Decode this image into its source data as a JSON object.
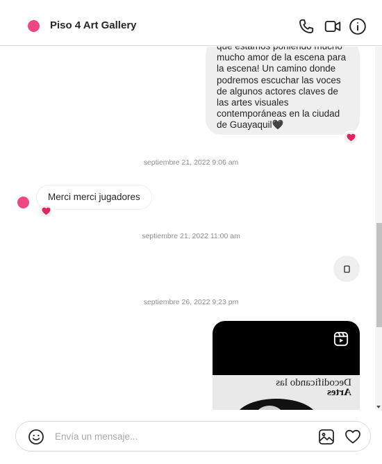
{
  "header": {
    "title": "Piso 4 Art Gallery",
    "avatar_color": "#f0477f",
    "icons": [
      "phone-icon",
      "video-icon",
      "info-icon"
    ]
  },
  "thread": {
    "outgoing_message": "que estamos poniendo mucho mucho amor de la escena para la escena! Un camino donde podremos escuchar las voces de algunos actores claves de las artes visuales contemporáneas en la ciudad de Guayaquil🖤",
    "timestamps": [
      "septiembre 21, 2022 9:06 am",
      "septiembre 21, 2022 11:00 am",
      "septiembre 26, 2022 9:23 pm"
    ],
    "incoming_message": "Merci merci jugadores",
    "reel_preview_text": {
      "line1": "Decodificando las",
      "line2": "Artes"
    }
  },
  "composer": {
    "placeholder": "Envía un mensaje..."
  },
  "colors": {
    "reaction_heart": "#e0245e",
    "bubble_gray": "#efefef"
  }
}
